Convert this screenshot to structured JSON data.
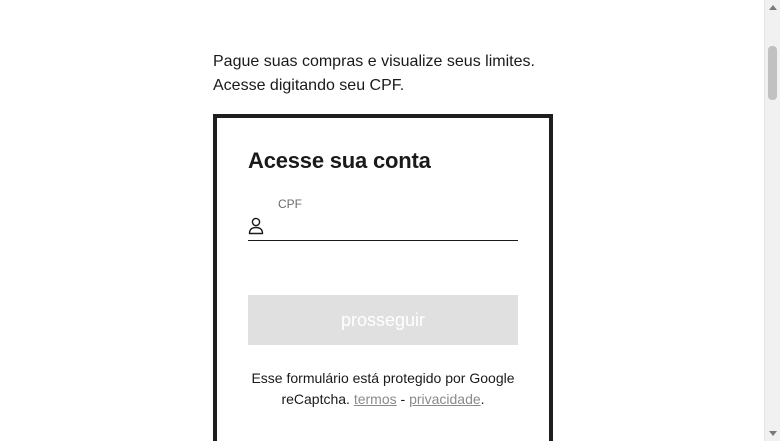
{
  "intro": {
    "line1": "Pague suas compras e visualize seus limites.",
    "line2": "Acesse digitando seu CPF."
  },
  "login": {
    "title": "Acesse sua conta",
    "cpf_label": "CPF",
    "cpf_value": "",
    "submit_label": "prosseguir",
    "recaptcha_text": "Esse formulário está protegido por Google reCaptcha. ",
    "terms_link": "termos",
    "separator": " - ",
    "privacy_link": "privacidade",
    "period": "."
  },
  "colors": {
    "border": "#1e1e1e",
    "button_disabled_bg": "#e0e0e0",
    "link_gray": "#8a8a8a"
  },
  "icons": {
    "field_icon": "user-icon"
  }
}
